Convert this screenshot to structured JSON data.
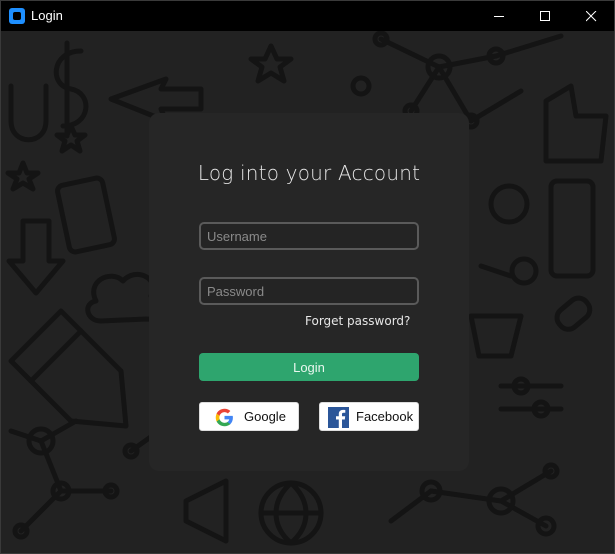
{
  "window": {
    "title": "Login"
  },
  "login": {
    "heading": "Log into your Account",
    "username_placeholder": "Username",
    "password_placeholder": "Password",
    "forgot_label": "Forget password?",
    "login_label": "Login",
    "google_label": "Google",
    "facebook_label": "Facebook"
  },
  "colors": {
    "accent": "#2ea56e",
    "card": "#262626",
    "background": "#222222",
    "facebook": "#2b5699"
  },
  "icons": [
    "app-icon",
    "minimize-icon",
    "maximize-icon",
    "close-icon",
    "google-icon",
    "facebook-icon"
  ]
}
